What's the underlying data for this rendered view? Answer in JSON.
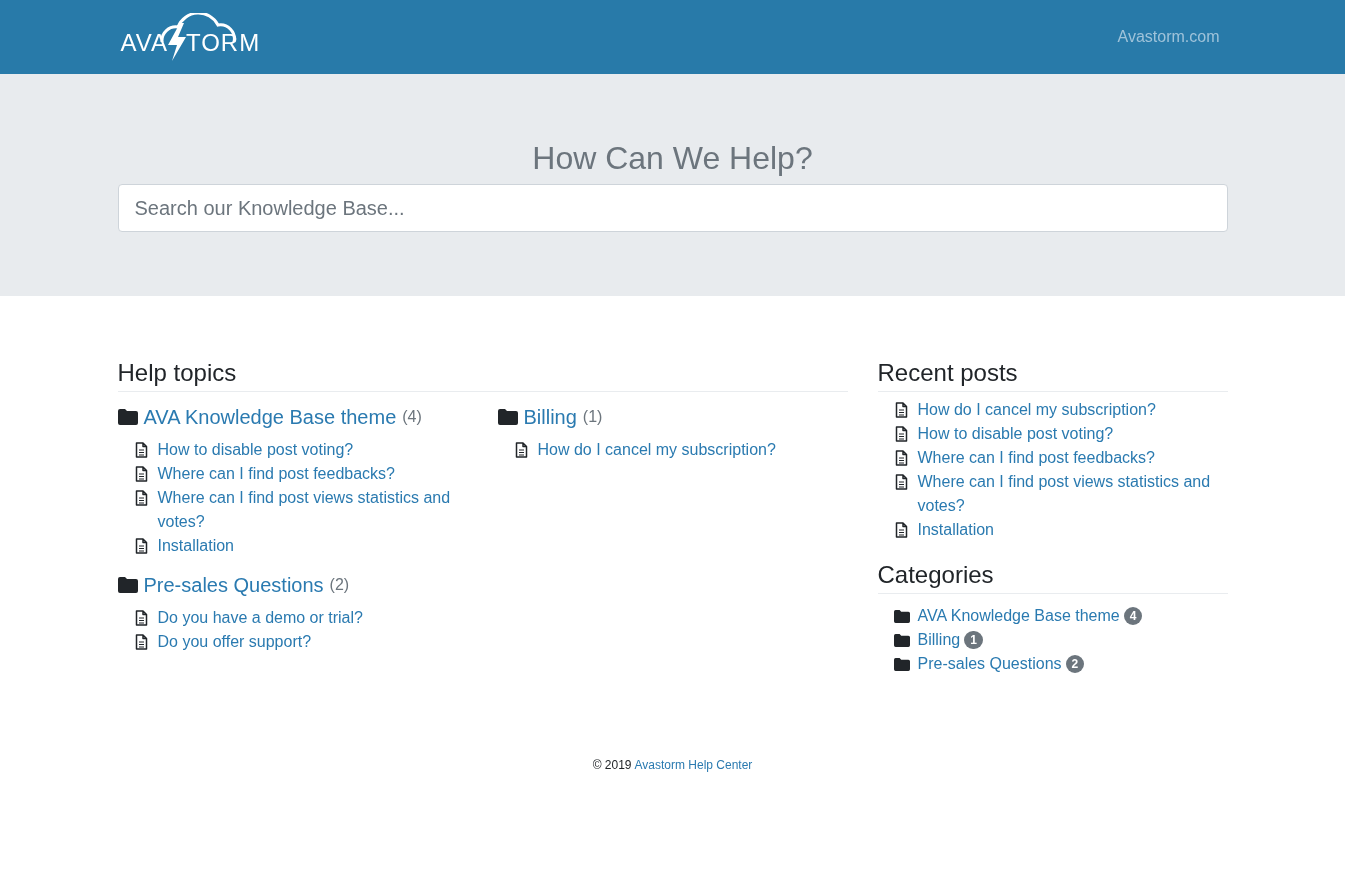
{
  "header": {
    "logo": {
      "left": "AVA",
      "right": "TORM"
    },
    "nav_link": "Avastorm.com"
  },
  "hero": {
    "title": "How Can We Help?",
    "search": {
      "placeholder": "Search our Knowledge Base..."
    }
  },
  "help_topics": {
    "title": "Help topics",
    "categories": [
      {
        "name": "AVA Knowledge Base theme",
        "count": "(4)",
        "articles": [
          "How to disable post voting?",
          "Where can I find post feedbacks?",
          "Where can I find post views statistics and votes?",
          "Installation"
        ]
      },
      {
        "name": "Billing",
        "count": "(1)",
        "articles": [
          "How do I cancel my subscription?"
        ]
      },
      {
        "name": "Pre-sales Questions",
        "count": "(2)",
        "articles": [
          "Do you have a demo or trial?",
          "Do you offer support?"
        ]
      }
    ]
  },
  "recent_posts": {
    "title": "Recent posts",
    "items": [
      "How do I cancel my subscription?",
      "How to disable post voting?",
      "Where can I find post feedbacks?",
      "Where can I find post views statistics and votes?",
      "Installation"
    ]
  },
  "categories": {
    "title": "Categories",
    "items": [
      {
        "name": "AVA Knowledge Base theme",
        "count": "4"
      },
      {
        "name": "Billing",
        "count": "1"
      },
      {
        "name": "Pre-sales Questions",
        "count": "2"
      }
    ]
  },
  "footer": {
    "copyright": "© 2019",
    "link": "Avastorm Help Center"
  }
}
